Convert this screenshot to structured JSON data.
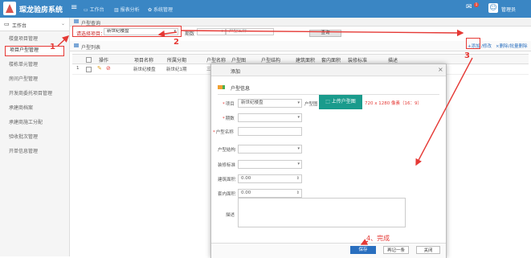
{
  "header": {
    "app_title": "琛龙验房系统",
    "nav": [
      "工作台",
      "报表分析",
      "系统管理"
    ],
    "msg_count": "1",
    "username": "管理员"
  },
  "sidebar": {
    "section": "工作台",
    "items": [
      "楼盘项目管理",
      "项目户型管理",
      "楼栋单元管理",
      "房间户型管理",
      "开发商委托项目管理",
      "承建商档案",
      "承建商施工分配",
      "验收批次管理",
      "开单信息管理"
    ]
  },
  "query": {
    "title": "户型查询",
    "project_label": "请选择项目：",
    "project_value": "新世纪楼盘",
    "period_label": "期数",
    "name_placeholder": "户型名称",
    "search_btn": "查询"
  },
  "list": {
    "title": "户型列表",
    "actions": [
      "+添加",
      "/修改",
      "×删除/批量删除"
    ],
    "columns": [
      "操作",
      "项目名称",
      "所属分期",
      "户型名称",
      "户型图",
      "户型结构",
      "建筑面积",
      "套内面积",
      "装修标准",
      "描述"
    ],
    "rows": [
      {
        "index": "1",
        "project": "新世纪楼盘",
        "period": "新世纪1期",
        "name": "三"
      }
    ]
  },
  "dialog": {
    "title": "添加",
    "section": "户型信息",
    "fields": {
      "project_label": "项目",
      "project_value": "新世纪楼盘",
      "period_label": "期数",
      "name_label": "户型名称",
      "structure_label": "户型结构",
      "decoration_label": "装修标准",
      "build_area_label": "建筑面积",
      "build_area_value": "0.00",
      "inner_area_label": "套内面积",
      "inner_area_value": "0.00",
      "desc_label": "描述",
      "image_label": "户型图"
    },
    "upload_btn": "上传户型图",
    "upload_hint": "720 x 1280 像素（16：9）",
    "buttons": {
      "save": "保存",
      "again": "再记一条",
      "close": "关闭"
    }
  },
  "annotations": {
    "n1": "1",
    "n2": "2",
    "n3": "3",
    "n4": "4、完成"
  },
  "colors": {
    "header": "#3a86c4",
    "annotation": "#e53935",
    "upload": "#1a9b8c",
    "save": "#2a6fbf"
  }
}
